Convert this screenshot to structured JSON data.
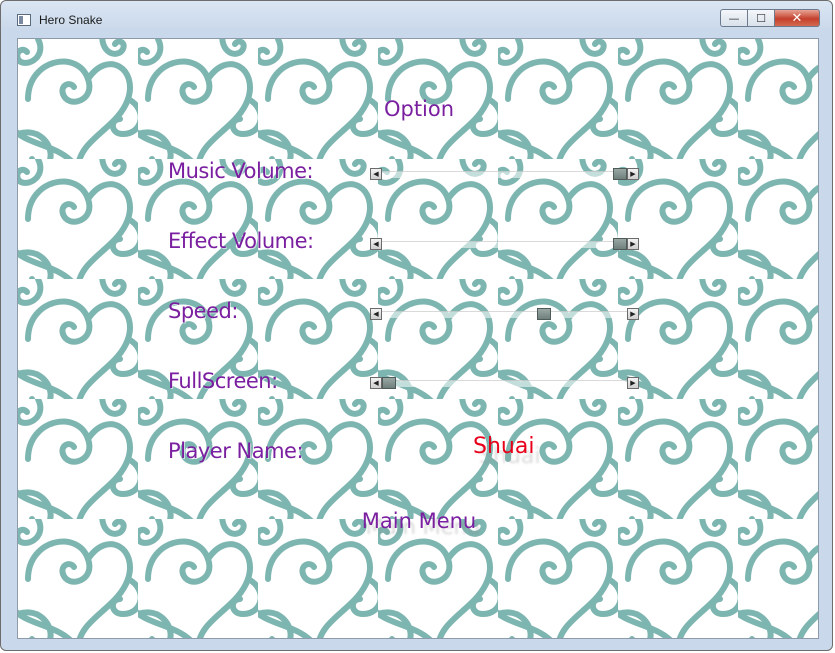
{
  "window": {
    "title": "Hero Snake",
    "minimize": "—",
    "maximize": "☐",
    "close": "✕"
  },
  "menu": {
    "heading": "Option",
    "music_volume_label": "Music Volume:",
    "effect_volume_label": "Effect Volume:",
    "speed_label": "Speed:",
    "fullscreen_label": "FullScreen:",
    "player_name_label": "Player Name:",
    "player_name_value": "Shuai",
    "main_menu": "Main Menu"
  },
  "sliders": {
    "music_volume": 1.0,
    "effect_volume": 1.0,
    "speed": 0.7,
    "fullscreen": 0.0
  },
  "colors": {
    "label": "#7a1fa0",
    "player_name": "#e8001a",
    "pattern": "#7db5b0"
  }
}
